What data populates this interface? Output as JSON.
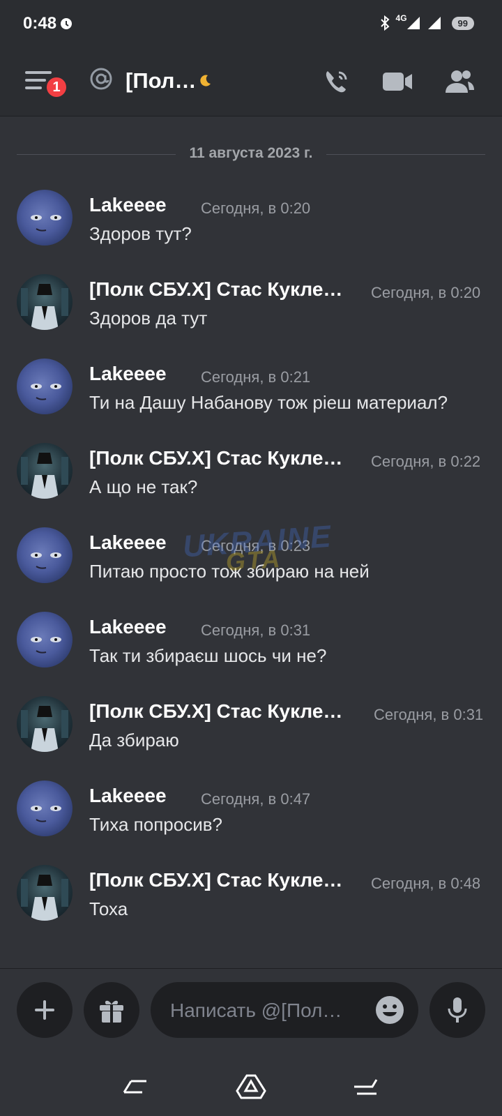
{
  "status_bar": {
    "time": "0:48",
    "network": "4G",
    "battery": "99"
  },
  "header": {
    "unread_count": "1",
    "channel_name": "[Пол…"
  },
  "date_divider": "11 августа 2023 г.",
  "messages": [
    {
      "author": "Lakeeee",
      "time": "Сегодня, в 0:20",
      "text": "Здоров тут?",
      "avatar": "blue-face"
    },
    {
      "author": "[Полк СБУ.X] Стас Кукле…",
      "time": "Сегодня, в 0:20",
      "text": "Здоров да тут",
      "avatar": "masked-figure"
    },
    {
      "author": "Lakeeee",
      "time": "Сегодня, в 0:21",
      "text": "Ти на Дашу Набанову тож рieш материал?",
      "avatar": "blue-face"
    },
    {
      "author": "[Полк СБУ.X] Стас Кукле…",
      "time": "Сегодня, в 0:22",
      "text": "А що не так?",
      "avatar": "masked-figure"
    },
    {
      "author": "Lakeeee",
      "time": "Сегодня, в 0:23",
      "text": "Питаю просто тож збираю на ней",
      "avatar": "blue-face"
    },
    {
      "author": "Lakeeee",
      "time": "Сегодня, в 0:31",
      "text": "Так ти збираєш шось чи не?",
      "avatar": "blue-face"
    },
    {
      "author": "[Полк СБУ.X] Стас Кукле…",
      "time": "Сегодня, в 0:31",
      "text": "Да збираю",
      "avatar": "masked-figure"
    },
    {
      "author": "Lakeeee",
      "time": "Сегодня, в 0:47",
      "text": "Тиха попросив?",
      "avatar": "blue-face"
    },
    {
      "author": "[Полк СБУ.X] Стас Кукле…",
      "time": "Сегодня, в 0:48",
      "text": "Тоха",
      "avatar": "masked-figure"
    }
  ],
  "composer": {
    "placeholder": "Написать @[Пол…"
  },
  "watermark": {
    "line1": "UKRAINE",
    "line2": "GTA"
  },
  "colors": {
    "background": "#313338",
    "header": "#2b2d31",
    "badge": "#f23f43",
    "input": "#1e1f22"
  }
}
